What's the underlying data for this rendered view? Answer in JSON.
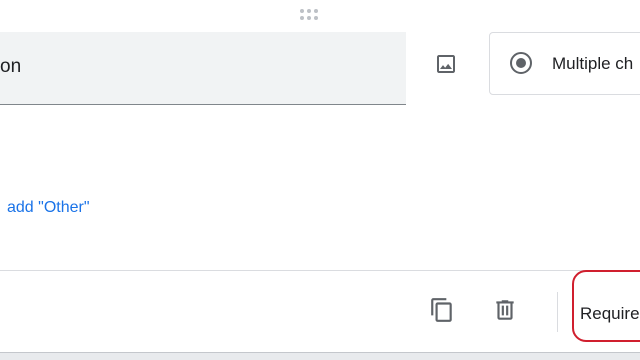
{
  "question": {
    "title_text": "on"
  },
  "question_type": {
    "selected_label": "Multiple ch"
  },
  "options": {
    "add_other_label": "add \"Other\""
  },
  "footer": {
    "required_label": "Require"
  },
  "icons": {
    "drag": "drag-handle-icon",
    "image": "image-icon",
    "radio": "radio-button-checked-icon",
    "copy": "content-copy-icon",
    "delete": "trash-icon"
  },
  "colors": {
    "accent": "#1a73e8",
    "highlight_outline": "#d01f2e",
    "icon_gray": "#5f6368",
    "field_bg": "#f1f3f4"
  }
}
